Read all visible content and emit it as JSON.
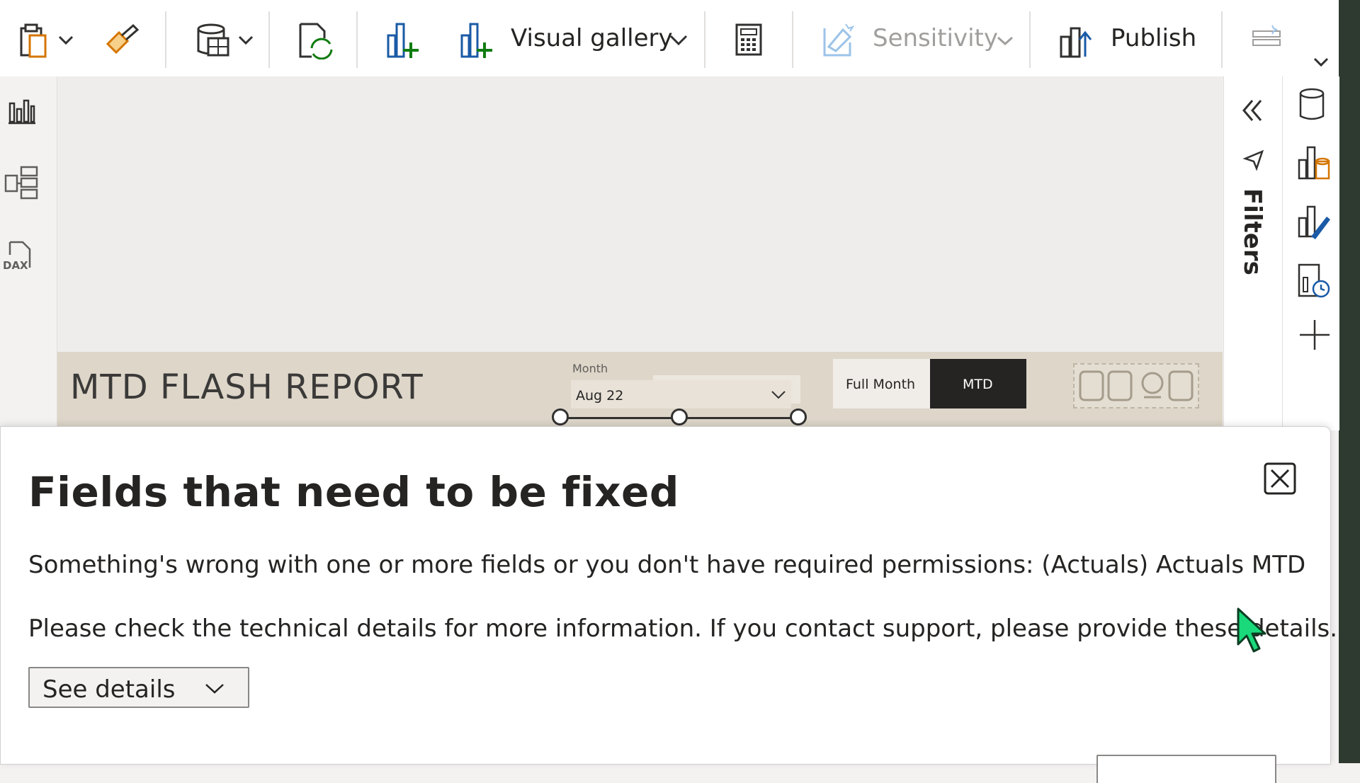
{
  "ribbon": {
    "visual_gallery_label": "Visual gallery",
    "sensitivity_label": "Sensitivity",
    "publish_label": "Publish"
  },
  "filters_label": "Filters",
  "report": {
    "title": "MTD FLASH REPORT",
    "month_label": "Month",
    "month_value": "Aug 22",
    "toggle_full_month": "Full Month",
    "toggle_mtd": "MTD",
    "toggle_selected": "MTD"
  },
  "dialog": {
    "title": "Fields that need to be fixed",
    "message": "Something's wrong with one or more fields or you don't have required permissions: (Actuals) Actuals MTD",
    "detail": "Please check the technical details for more information. If you contact support, please provide these details.",
    "see_details_label": "See details"
  },
  "colors": {
    "accent_green": "#107c10",
    "dark_toggle": "#252423",
    "banner": "#ddd6c9",
    "cursor": "#19d97a"
  },
  "icons": [
    "paste-icon",
    "format-painter-icon",
    "get-data-icon",
    "refresh-icon",
    "new-visual-icon",
    "more-visuals-icon",
    "new-measure-icon",
    "sensitivity-icon",
    "publish-icon",
    "copilot-icon",
    "report-view-icon",
    "model-view-icon",
    "dax-query-icon",
    "collapse-icon",
    "filter-icon",
    "data-pane-icon",
    "build-visual-icon",
    "format-visual-icon",
    "performance-icon",
    "add-pane-icon",
    "close-icon",
    "chevron-down-icon"
  ]
}
